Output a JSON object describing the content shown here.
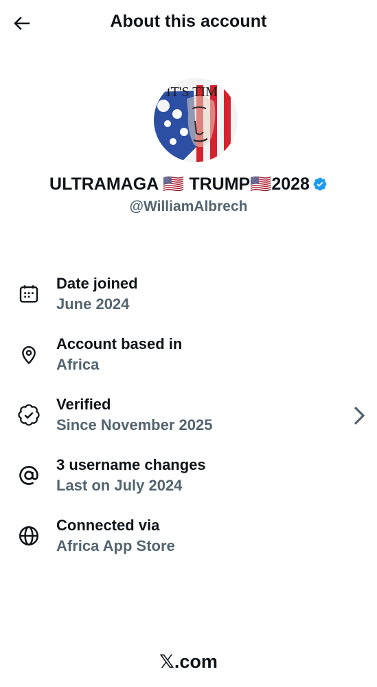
{
  "header": {
    "title": "About this account"
  },
  "profile": {
    "display_name": "ULTRAMAGA 🇺🇸 TRUMP🇺🇸2028",
    "handle": "@WilliamAlbrech",
    "avatar_text": "IT'S TIM",
    "verified": true
  },
  "info": [
    {
      "icon": "calendar-icon",
      "title": "Date joined",
      "subtitle": "June 2024"
    },
    {
      "icon": "location-pin-icon",
      "title": "Account based in",
      "subtitle": "Africa"
    },
    {
      "icon": "verified-check-icon",
      "title": "Verified",
      "subtitle": "Since November 2025"
    },
    {
      "icon": "at-sign-icon",
      "title": "3 username changes",
      "subtitle": "Last on July 2024"
    },
    {
      "icon": "globe-icon",
      "title": "Connected via",
      "subtitle": "Africa App Store"
    }
  ],
  "footer": {
    "brand": "𝕏.com"
  },
  "colors": {
    "text_primary": "#0f1419",
    "text_secondary": "#536471",
    "verified_blue": "#1d9bf0"
  }
}
